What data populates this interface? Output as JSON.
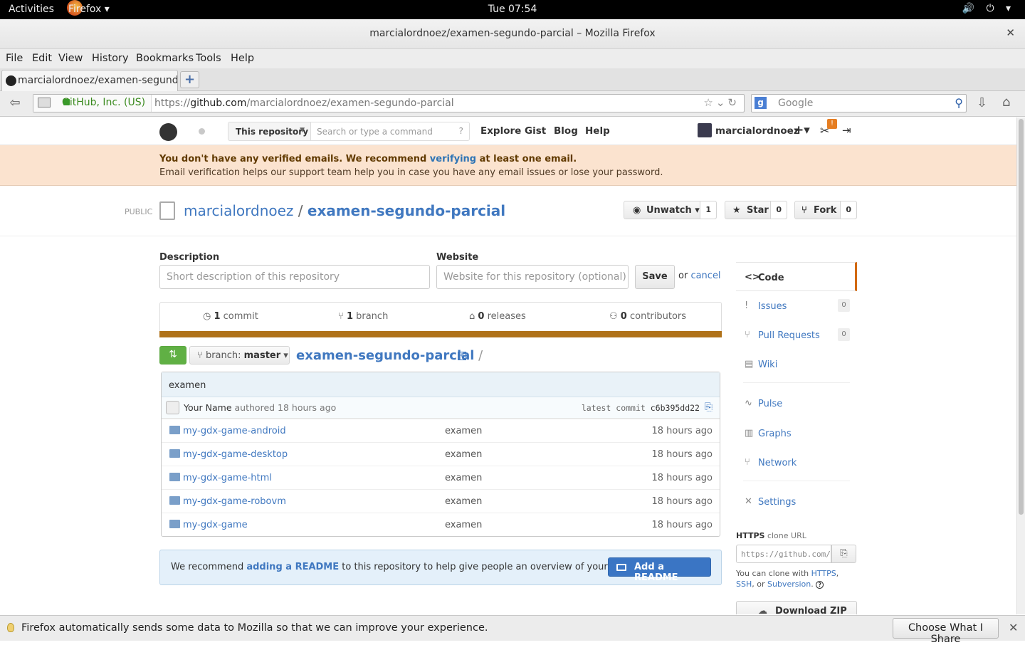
{
  "topbar": {
    "activities": "Activities",
    "app_menu": "Firefox ▾",
    "clock": "Tue 07:54",
    "system_icons": "🔊 ⏻ ▾"
  },
  "window": {
    "title": "marcialordnoez/examen-segundo-parcial – Mozilla Firefox",
    "close": "✕"
  },
  "menubar": [
    "File",
    "Edit",
    "View",
    "History",
    "Bookmarks",
    "Tools",
    "Help"
  ],
  "tab": {
    "title": "marcialordnoez/examen-segund...",
    "new_tab": "+"
  },
  "navbar": {
    "identity": "GitHub, Inc. (US)",
    "url_prefix": "https://",
    "url_host": "github.com",
    "url_path": "/marcialordnoez/examen-segundo-parcial",
    "search_placeholder": "Google",
    "search_engine_letter": "g"
  },
  "gh_header": {
    "scope": "This repository",
    "search_placeholder": "Search or type a command",
    "nav": [
      "Explore",
      "Gist",
      "Blog",
      "Help"
    ],
    "username": "marcialordnoez",
    "plus": "+▾",
    "tools_badge": "!"
  },
  "flash": {
    "line1_a": "You don't have any verified emails. We recommend ",
    "line1_link": "verifying",
    "line1_b": " at least one email.",
    "line2": "Email verification helps our support team help you in case you have any email issues or lose your password."
  },
  "repo": {
    "visibility": "PUBLIC",
    "owner": "marcialordnoez",
    "separator": "/",
    "name": "examen-segundo-parcial",
    "watch_label": "Unwatch ▾",
    "watch_count": "1",
    "star_label": "Star",
    "star_count": "0",
    "fork_label": "Fork",
    "fork_count": "0"
  },
  "edit": {
    "description_label": "Description",
    "description_placeholder": "Short description of this repository",
    "website_label": "Website",
    "website_placeholder": "Website for this repository (optional)",
    "save": "Save",
    "or": "or ",
    "cancel": "cancel"
  },
  "stats": {
    "commits_n": "1",
    "commits_label": " commit",
    "branches_n": "1",
    "branches_label": " branch",
    "releases_n": "0",
    "releases_label": " releases",
    "contributors_n": "0",
    "contributors_label": " contributors",
    "language_color": "#b07219"
  },
  "filenav": {
    "branch_prefix": "branch: ",
    "branch": "master",
    "crumb": "examen-segundo-parcial",
    "crumb_sep": " /"
  },
  "commit": {
    "message": "examen",
    "author": "Your Name",
    "authored": " authored 18 hours ago",
    "latest_label": "latest commit ",
    "sha": "c6b395dd22"
  },
  "files": [
    {
      "name": "my-gdx-game-android",
      "message": "examen",
      "age": "18 hours ago"
    },
    {
      "name": "my-gdx-game-desktop",
      "message": "examen",
      "age": "18 hours ago"
    },
    {
      "name": "my-gdx-game-html",
      "message": "examen",
      "age": "18 hours ago"
    },
    {
      "name": "my-gdx-game-robovm",
      "message": "examen",
      "age": "18 hours ago"
    },
    {
      "name": "my-gdx-game",
      "message": "examen",
      "age": "18 hours ago"
    }
  ],
  "readme": {
    "msg_a": "We recommend ",
    "msg_link": "adding a README",
    "msg_b": " to this repository to help give people an overview of your project.",
    "button": "Add a README"
  },
  "sidebar": {
    "items": [
      {
        "label": "Code",
        "icon": "<>"
      },
      {
        "label": "Issues",
        "icon": "!",
        "count": "0"
      },
      {
        "label": "Pull Requests",
        "icon": "⑂",
        "count": "0"
      },
      {
        "label": "Wiki",
        "icon": "▤"
      },
      {
        "label": "Pulse",
        "icon": "∿"
      },
      {
        "label": "Graphs",
        "icon": "▥"
      },
      {
        "label": "Network",
        "icon": "⑂"
      },
      {
        "label": "Settings",
        "icon": "✕"
      }
    ],
    "clone_proto": "HTTPS",
    "clone_label": " clone URL",
    "clone_url": "https://github.com/marcialordnoez/examen-segundo-parcial.git",
    "clone_note_a": "You can clone with ",
    "clone_https": "HTTPS",
    "clone_comma": ", ",
    "clone_ssh": "SSH",
    "clone_or": ", or ",
    "clone_subversion": "Subversion",
    "clone_end": ". ",
    "download_zip": "Download ZIP"
  },
  "notification": {
    "message": "Firefox automatically sends some data to Mozilla so that we can improve your experience.",
    "button": "Choose What I Share",
    "close": "✕"
  }
}
